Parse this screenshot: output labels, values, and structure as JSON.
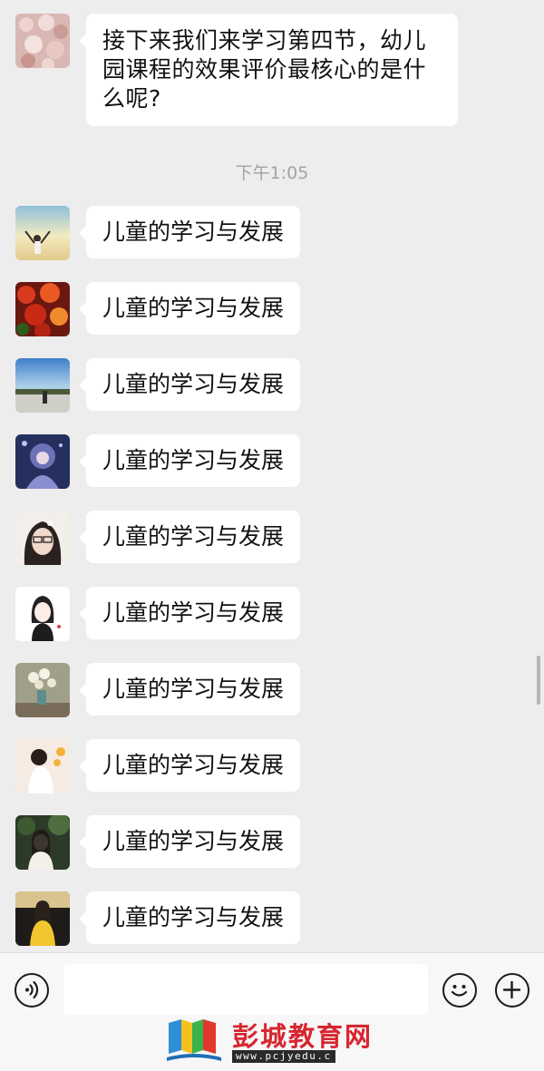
{
  "messages": {
    "first": {
      "text": "接下来我们来学习第四节，幼儿园课程的效果评价最核心的是什么呢?"
    },
    "timestamp": "下午1:05",
    "replies": [
      {
        "text": "儿童的学习与发展"
      },
      {
        "text": "儿童的学习与发展"
      },
      {
        "text": "儿童的学习与发展"
      },
      {
        "text": "儿童的学习与发展"
      },
      {
        "text": "儿童的学习与发展"
      },
      {
        "text": "儿童的学习与发展"
      },
      {
        "text": "儿童的学习与发展"
      },
      {
        "text": "儿童的学习与发展"
      },
      {
        "text": "儿童的学习与发展"
      },
      {
        "text": "儿童的学习与发展"
      }
    ]
  },
  "input_bar": {
    "message_value": "",
    "voice_icon": "voice-icon",
    "emoji_icon": "emoji-icon",
    "plus_icon": "plus-icon"
  },
  "watermark": {
    "title": "彭城教育网",
    "url": "www.pcjyedu.c"
  },
  "colors": {
    "background": "#ededed",
    "bubble": "#ffffff",
    "timestamp": "#a3a3a3",
    "watermark_red": "#d8262f"
  }
}
